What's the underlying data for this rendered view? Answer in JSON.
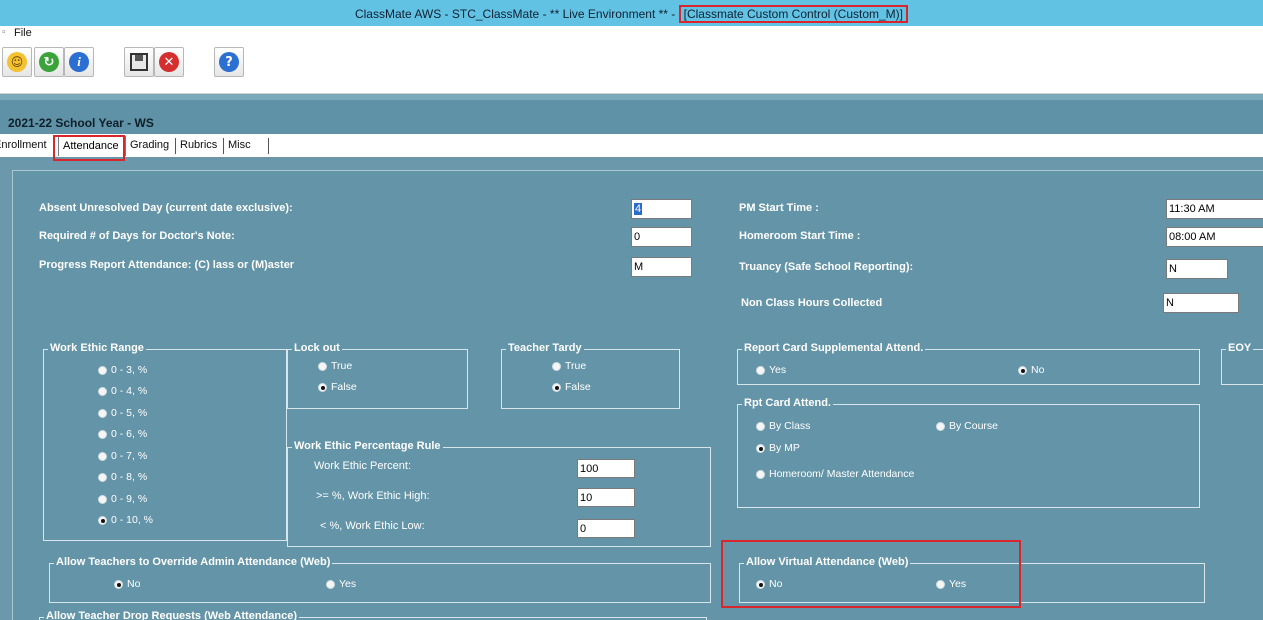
{
  "window": {
    "title_prefix": "ClassMate AWS - STC_ClassMate - ** Live Environment ** - ",
    "title_highlight": "[Classmate Custom Control (Custom_M)]"
  },
  "menu": {
    "file": "File"
  },
  "toolbar": {
    "buttons": [
      "smiley-icon",
      "refresh-icon",
      "info-icon",
      "save-icon",
      "close-icon",
      "help-icon"
    ]
  },
  "school_year": "2021-22 School Year - WS",
  "tabs": {
    "enrollment": "Enrollment",
    "attendance": "Attendance",
    "grading": "Grading",
    "rubrics": "Rubrics",
    "misc": "Misc"
  },
  "fields": {
    "absent_label": "Absent Unresolved Day  (current date exclusive):",
    "absent_value": "4",
    "doctors_note_label": "Required # of Days for Doctor's Note:",
    "doctors_note_value": "0",
    "progress_label": "Progress Report Attendance: (C) lass or (M)aster",
    "progress_value": "M",
    "pm_start_label": "PM Start Time :",
    "pm_start_value": "11:30 AM",
    "homeroom_label": "Homeroom Start Time :",
    "homeroom_value": "08:00 AM",
    "truancy_label": "Truancy (Safe School Reporting):",
    "truancy_value": "N",
    "nonclass_label": "Non Class Hours Collected",
    "nonclass_value": "N"
  },
  "work_ethic_range": {
    "title": "Work Ethic Range",
    "options": [
      "0 - 3, %",
      "0 - 4, %",
      "0 - 5, %",
      "0 - 6, %",
      "0 - 7, %",
      "0 - 8, %",
      "0 - 9, %",
      "0 - 10, %"
    ],
    "selected_index": 7
  },
  "lock_out": {
    "title": "Lock out",
    "true_label": "True",
    "false_label": "False",
    "selected": "False"
  },
  "teacher_tardy": {
    "title": "Teacher Tardy",
    "true_label": "True",
    "false_label": "False",
    "selected": "False"
  },
  "work_ethic_rule": {
    "title": "Work Ethic Percentage Rule",
    "percent_label": "Work Ethic Percent:",
    "percent_value": "100",
    "high_label": ">= %, Work Ethic High:",
    "high_value": "10",
    "low_label": "< %, Work Ethic Low:",
    "low_value": "0"
  },
  "report_card_supp": {
    "title": "Report Card Supplemental Attend.",
    "yes_label": "Yes",
    "no_label": "No",
    "selected": "No"
  },
  "eoy": {
    "title": "EOY"
  },
  "rpt_card_attend": {
    "title": "Rpt Card Attend.",
    "by_class": "By Class",
    "by_course": "By Course",
    "by_mp": "By MP",
    "homeroom": "Homeroom/ Master Attendance",
    "selected": "By MP"
  },
  "override_admin": {
    "title": "Allow Teachers to Override Admin Attendance (Web)",
    "no_label": "No",
    "yes_label": "Yes",
    "selected": "No"
  },
  "virtual_attendance": {
    "title": "Allow Virtual Attendance (Web)",
    "no_label": "No",
    "yes_label": "Yes",
    "selected": "No"
  },
  "drop_requests": {
    "title": "Allow Teacher Drop Requests (Web Attendance)"
  },
  "colors": {
    "titlebar": "#62c2e4",
    "panel": "#6494a7",
    "highlight": "#d9262c"
  }
}
